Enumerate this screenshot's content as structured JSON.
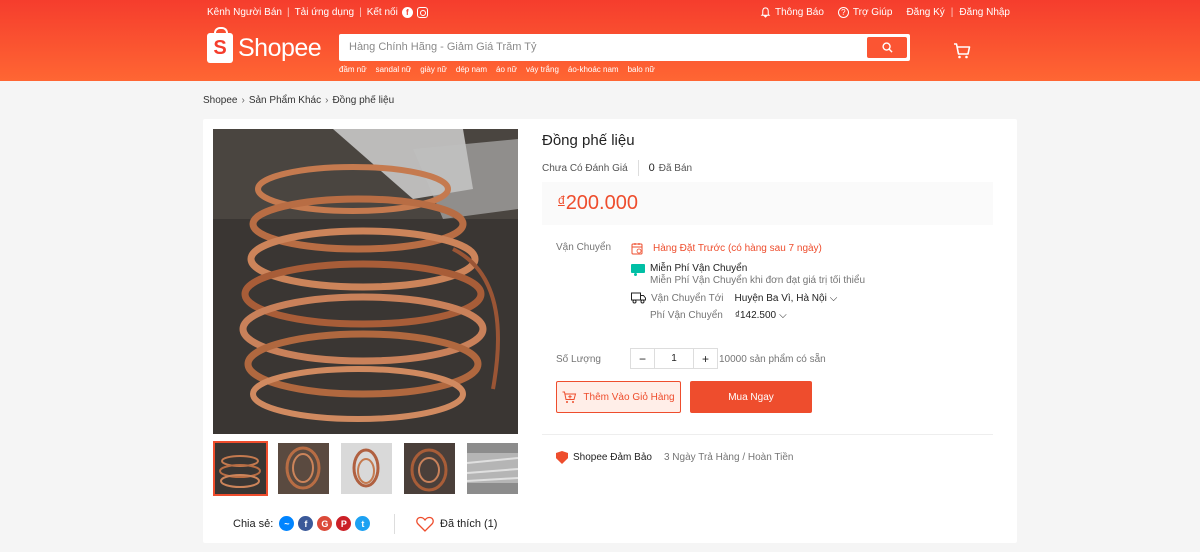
{
  "topbar": {
    "seller_center": "Kênh Người Bán",
    "download_app": "Tải ứng dụng",
    "connect": "Kết nối",
    "notifications": "Thông Báo",
    "help": "Trợ Giúp",
    "register": "Đăng Ký",
    "login": "Đăng Nhập"
  },
  "logo": {
    "text": "Shopee",
    "glyph": "S"
  },
  "search": {
    "placeholder": "Hàng Chính Hãng - Giảm Giá Trăm Tỷ",
    "keywords": [
      "đầm nữ",
      "sandal nữ",
      "giày nữ",
      "dép nam",
      "áo nữ",
      "váy trắng",
      "áo-khoác nam",
      "balo nữ"
    ]
  },
  "breadcrumb": [
    "Shopee",
    "Sản Phẩm Khác",
    "Đồng phế liệu"
  ],
  "product": {
    "title": "Đồng phế liệu",
    "rating_text": "Chưa Có Đánh Giá",
    "sold_count": "0",
    "sold_label": "Đã Bán",
    "currency": "đ",
    "price": "200.000"
  },
  "shipping": {
    "label": "Vận Chuyển",
    "preorder": "Hàng Đặt Trước (có hàng sau 7 ngày)",
    "free_title": "Miễn Phí Vận Chuyển",
    "free_desc": "Miễn Phí Vận Chuyển khi đơn đạt giá trị tối thiểu",
    "ship_to_label": "Vận Chuyển Tới",
    "ship_to_value": "Huyện Ba Vì, Hà Nội",
    "fee_label": "Phí Vận Chuyển",
    "fee_value": "₫142.500"
  },
  "quantity": {
    "label": "Số Lượng",
    "minus": "−",
    "value": "1",
    "plus": "+",
    "stock": "10000 sản phẩm có sẵn"
  },
  "actions": {
    "add_to_cart": "Thêm Vào Giỏ Hàng",
    "buy_now": "Mua Ngay"
  },
  "guarantee": {
    "title": "Shopee Đảm Bảo",
    "desc": "3 Ngày Trả Hàng / Hoàn Tiền"
  },
  "share": {
    "label": "Chia sẻ:",
    "icons": [
      "messenger-icon",
      "facebook-icon",
      "google-plus-icon",
      "pinterest-icon",
      "twitter-icon"
    ]
  },
  "like": {
    "label": "Đã thích (1)"
  },
  "colors": {
    "brand": "#ee4d2d",
    "header": "#f53d2d"
  }
}
